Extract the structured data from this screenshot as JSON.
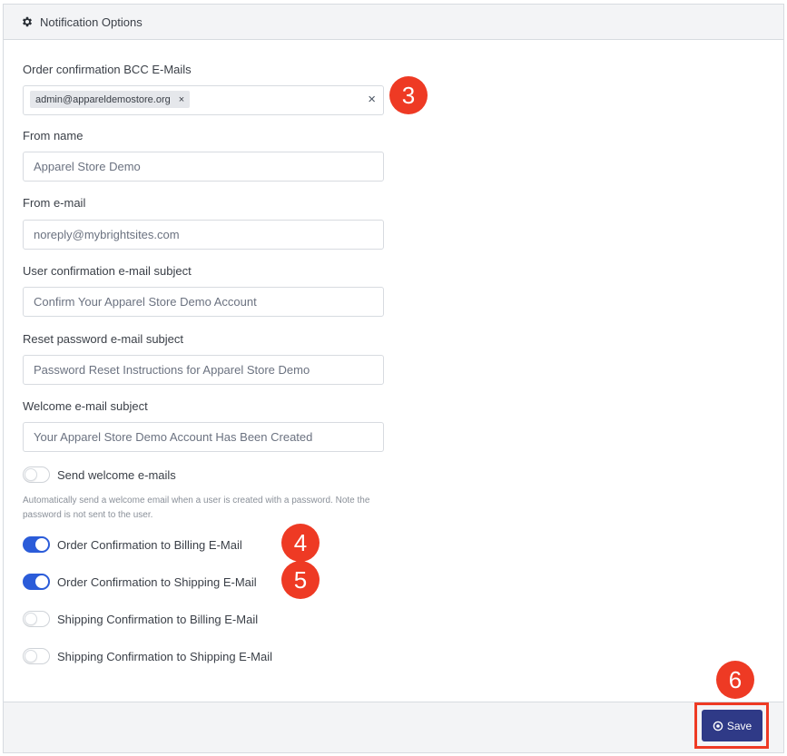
{
  "header": {
    "title": "Notification Options",
    "icon": "gear-icon"
  },
  "bcc": {
    "label": "Order confirmation BCC E-Mails",
    "tags": [
      "admin@appareldemostore.org"
    ],
    "tag_remove": "×",
    "clear": "×"
  },
  "from_name": {
    "label": "From name",
    "value": "Apparel Store Demo"
  },
  "from_email": {
    "label": "From e-mail",
    "value": "noreply@mybrightsites.com"
  },
  "user_confirmation_subject": {
    "label": "User confirmation e-mail subject",
    "value": "Confirm Your Apparel Store Demo Account"
  },
  "reset_password_subject": {
    "label": "Reset password e-mail subject",
    "value": "Password Reset Instructions for Apparel Store Demo"
  },
  "welcome_subject": {
    "label": "Welcome e-mail subject",
    "value": "Your Apparel Store Demo Account Has Been Created"
  },
  "toggles": {
    "send_welcome": {
      "label": "Send welcome e-mails",
      "on": false
    },
    "help": "Automatically send a welcome email when a user is created with a password. Note the password is not sent to the user.",
    "order_billing": {
      "label": "Order Confirmation to Billing E-Mail",
      "on": true
    },
    "order_shipping": {
      "label": "Order Confirmation to Shipping E-Mail",
      "on": true
    },
    "ship_billing": {
      "label": "Shipping Confirmation to Billing E-Mail",
      "on": false
    },
    "ship_shipping": {
      "label": "Shipping Confirmation to Shipping E-Mail",
      "on": false
    }
  },
  "footer": {
    "save_label": "Save",
    "save_icon": "target-icon"
  },
  "annotations": [
    "3",
    "4",
    "5",
    "6"
  ],
  "colors": {
    "accent": "#2b5cd9",
    "save_button": "#2f3a87",
    "annotation": "#ee3a24"
  }
}
